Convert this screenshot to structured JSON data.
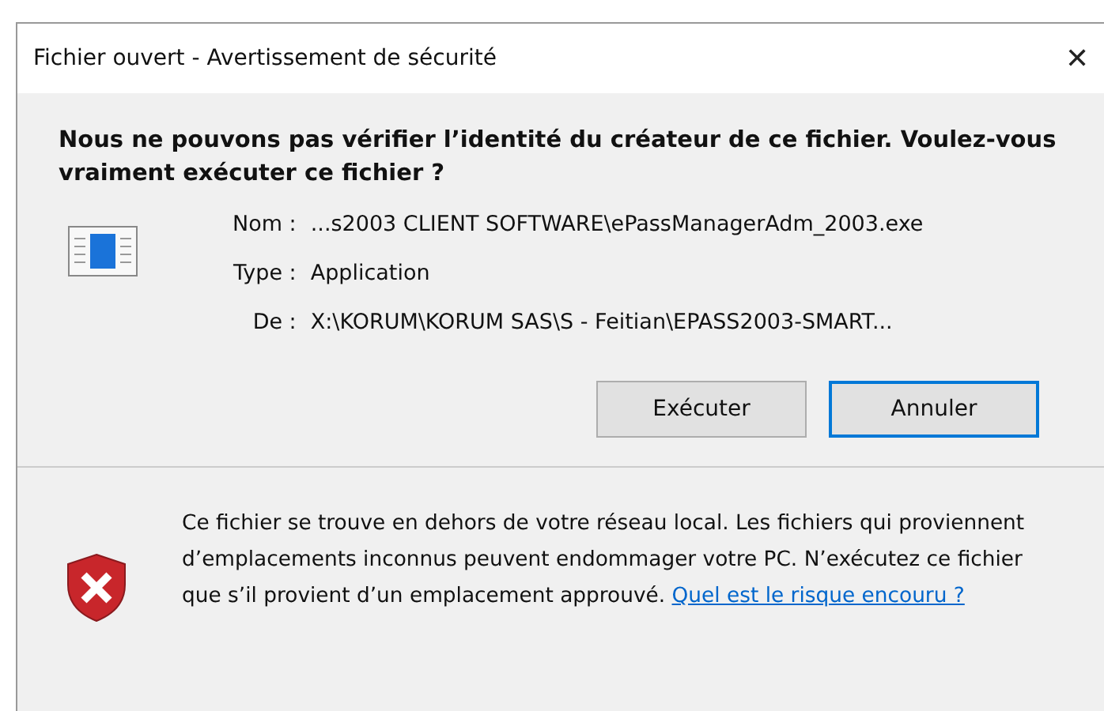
{
  "window": {
    "title": "Fichier ouvert - Avertissement de sécurité",
    "close": "✕"
  },
  "heading": "Nous ne pouvons pas vérifier l’identité du créateur de ce fichier. Voulez-vous vraiment exécuter ce fichier ?",
  "fields": [
    {
      "label": "Nom :",
      "value": "...s2003 CLIENT SOFTWARE\\ePassManagerAdm_2003.exe"
    },
    {
      "label": "Type :",
      "value": "Application"
    },
    {
      "label": "De :",
      "value": "X:\\KORUM\\KORUM SAS\\S - Feitian\\EPASS2003-SMART..."
    }
  ],
  "buttons": [
    {
      "label": "Exécuter",
      "selected": false
    },
    {
      "label": "Annuler",
      "selected": true
    }
  ],
  "warning": {
    "text": "Ce fichier se trouve en dehors de votre réseau local. Les fichiers qui proviennent d’emplacements inconnus peuvent endommager votre PC. N’exécutez ce fichier que s’il provient d’un emplacement approuvé.",
    "link": "Quel est le risque encouru ?"
  }
}
